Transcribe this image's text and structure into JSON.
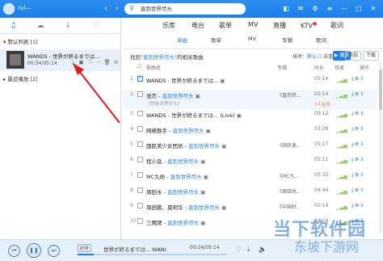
{
  "titlebar": {
    "username": "rui—",
    "search_value": "直到世界尽头",
    "window_buttons": [
      "◧",
      "✉",
      "⚙",
      "≡",
      "—",
      "□",
      "✕"
    ]
  },
  "sidebar": {
    "tabs": [
      "♫",
      "☁",
      "↓",
      "♡"
    ],
    "default_list": "默认列表",
    "default_count": "[1]",
    "current_song": {
      "title": "WANDS - 世界が終るまでは...",
      "time": "00:34/05:14"
    },
    "recent": "最近播放",
    "recent_count": "[2]"
  },
  "nav": [
    "乐库",
    "电台",
    "歌单",
    "MV",
    "直播",
    "KTV",
    "歌词"
  ],
  "subnav": [
    "单曲",
    "歌单",
    "MV",
    "专辑",
    "歌词"
  ],
  "results": {
    "prefix": "找到",
    "query": "\"直到世界尽头\"",
    "suffix": "的相关歌曲",
    "sort_label": "排序：",
    "sort_value": "默认",
    "nodup": "☐ 去重复",
    "play": "▶ 播放",
    "add": "添加",
    "download": "下载"
  },
  "table_header": {
    "name": "歌曲名",
    "album": "专辑",
    "time": "时长",
    "hot": "热度",
    "ops": "操作"
  },
  "rows": [
    {
      "num": "1",
      "title": "WANDS - 世界が終るまでは...",
      "artist": "",
      "sub": "",
      "album": "",
      "time": "05:14",
      "src": "",
      "checked": true
    },
    {
      "num": "2",
      "title": "张杰 - ",
      "artist": "直到世界尽头",
      "sub": "《终结世界尽头》",
      "album": "《直到世...",
      "time": "05:14",
      "src": "7人在听",
      "checked": false
    },
    {
      "num": "3",
      "title": "WANDS - 世界が終るまでは... (Live)",
      "artist": "",
      "sub": "",
      "album": "",
      "time": "05:12",
      "src": "",
      "checked": false
    },
    {
      "num": "4",
      "title": "网络歌手 - ",
      "artist": "直到世界尽头",
      "sub": "",
      "album": "",
      "time": "03:28",
      "src": "",
      "checked": false
    },
    {
      "num": "5",
      "title": "国民美少女团员 - ",
      "artist": "直到世界尽头",
      "sub": "",
      "album": "《国民美...",
      "time": "05:17",
      "src": "",
      "checked": false
    },
    {
      "num": "6",
      "title": "程小岳 - ",
      "artist": "直到世界尽头",
      "sub": "",
      "album": "",
      "time": "05:11",
      "src": "",
      "checked": false
    },
    {
      "num": "7",
      "title": "MC九局 - ",
      "artist": "直到世界尽头",
      "sub": "",
      "album": "《MC九...",
      "time": "05:32",
      "src": "",
      "checked": false
    },
    {
      "num": "8",
      "title": "周田水 - ",
      "artist": "直到世界尽头",
      "sub": "",
      "album": "《周田水...",
      "time": "04:44",
      "src": "",
      "checked": false
    },
    {
      "num": "9",
      "title": "周田鹏、莫玥华 - ",
      "artist": "直到世界尽头",
      "sub": "",
      "album": "《中国好...",
      "time": "05:14",
      "src": "",
      "checked": false
    },
    {
      "num": "10",
      "title": "三鹰牌 - ",
      "artist": "直到世界尽头",
      "sub": "",
      "album": "",
      "time": "04:19",
      "src": "",
      "checked": false
    }
  ],
  "player": {
    "tag": "好听",
    "title": "世界が終るまでは...   WANI",
    "time": "00:34/05:14",
    "progress": 0.11
  },
  "watermark": {
    "main": "当下软件园",
    "sub": "东坡下游网"
  }
}
